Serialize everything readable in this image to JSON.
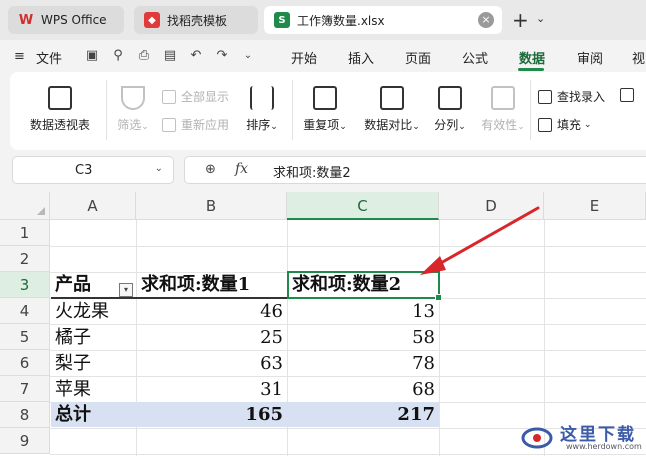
{
  "tabs": [
    {
      "label": "WPS Office",
      "icon": "wps-logo-icon"
    },
    {
      "label": "找稻壳模板",
      "icon": "docer-icon"
    },
    {
      "label": "工作簿数量.xlsx",
      "icon": "spreadsheet-icon",
      "active": true
    }
  ],
  "menu": {
    "file_label": "文件",
    "items": [
      "开始",
      "插入",
      "页面",
      "公式",
      "数据",
      "审阅",
      "视"
    ],
    "active": "数据"
  },
  "ribbon": {
    "pivot": "数据透视表",
    "filter": "筛选",
    "show_all": "全部显示",
    "reapply": "重新应用",
    "sort": "排序",
    "duplicates": "重复项",
    "compare": "数据对比",
    "split": "分列",
    "validity": "有效性",
    "lookup": "查找录入",
    "fill": "填充"
  },
  "formula_bar": {
    "name_box": "C3",
    "fx_label": "fx",
    "content": "求和项:数量2"
  },
  "sheet": {
    "columns": [
      "A",
      "B",
      "C",
      "D",
      "E"
    ],
    "selected_column": "C",
    "rows": [
      "1",
      "2",
      "3",
      "4",
      "5",
      "6",
      "7",
      "8",
      "9"
    ],
    "selected_row": "3",
    "pivot": {
      "headers": [
        "产品",
        "求和项:数量1",
        "求和项:数量2"
      ],
      "data": [
        [
          "火龙果",
          "46",
          "13"
        ],
        [
          "橘子",
          "25",
          "58"
        ],
        [
          "梨子",
          "63",
          "78"
        ],
        [
          "苹果",
          "31",
          "68"
        ]
      ],
      "total": [
        "总计",
        "165",
        "217"
      ]
    }
  },
  "watermark": {
    "title": "这里下载",
    "url": "www.herdown.com"
  },
  "colors": {
    "accent": "#1f8a4c",
    "total_row": "#d8e1f1",
    "arrow": "#d9262b"
  }
}
